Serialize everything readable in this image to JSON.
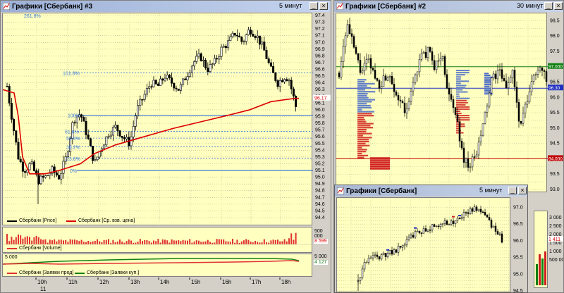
{
  "win1": {
    "title": "Графики [Сбербанк] #3",
    "timeframe": "5 минут",
    "price_axis": [
      "97.4",
      "97.3",
      "97.2",
      "97.1",
      "97.0",
      "96.9",
      "96.8",
      "96.7",
      "96.6",
      "96.5",
      "96.4",
      "96.3",
      "96.2",
      "96.1",
      "96.0",
      "95.9",
      "95.8",
      "95.7",
      "95.6",
      "95.5",
      "95.4",
      "95.3",
      "95.2",
      "95.1",
      "95.0",
      "94.9",
      "94.8",
      "94.7",
      "94.6",
      "94.5",
      "94.4"
    ],
    "fib_labels": [
      "261.8%",
      "161.8%",
      "100%",
      "61.8%",
      "50.0%",
      "38.2%",
      "23.6%",
      "0%"
    ],
    "last_price": "96.17",
    "legend_price": "Сбербанк [Price]",
    "legend_avg": "Сбербанк [Ср. взв. цена]",
    "volume_axis": "500 000",
    "volume_last": "8 599",
    "legend_volume": "Сбербанк [Volume]",
    "orders_axis": "5 000",
    "orders_last_top": "5 000",
    "orders_last": "4 127",
    "legend_sell": "Сбербанк [Заявки прод]",
    "legend_buy": "Сбербанк [Заявки куп.]",
    "time_labels": [
      "10h",
      "11h",
      "12h",
      "13h",
      "14h",
      "15h",
      "16h",
      "17h",
      "18h"
    ],
    "date_label": "11",
    "colors": {
      "price": "#000000",
      "avg": "#dd0000",
      "fib": "#3b7ad8",
      "volume": "#e03030"
    }
  },
  "win2": {
    "title": "Графики [Сбербанк] #2",
    "timeframe": "30 минут",
    "price_axis": [
      "98.5",
      "98.0",
      "97.5",
      "97.0",
      "96.5",
      "96.0",
      "95.5",
      "95.0",
      "94.5",
      "94.0",
      "93.5",
      "93.0"
    ],
    "level_top": "97.000",
    "level_mid": "96.30",
    "level_low": "94.000"
  },
  "win3": {
    "title": "Графики [Сбербанк]",
    "timeframe": "5 минут",
    "price_axis": [
      "97.0",
      "96.5",
      "96.0",
      "95.5",
      "95.0",
      "94.5"
    ]
  },
  "side": {
    "volume_axis": [
      "3 000",
      "2 500",
      "2 000",
      "1 500",
      "1 000",
      "500 000"
    ],
    "last": "1 411"
  }
}
